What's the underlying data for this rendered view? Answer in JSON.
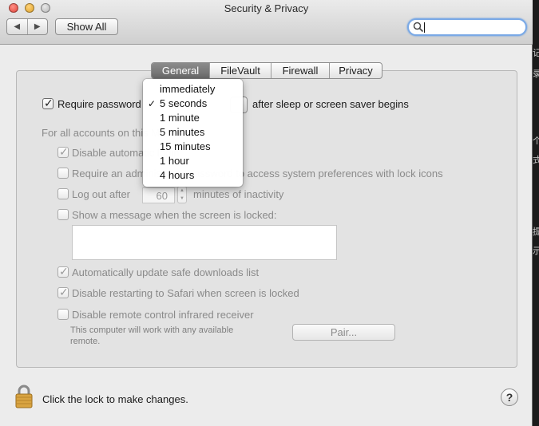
{
  "window": {
    "title": "Security & Privacy"
  },
  "toolbar": {
    "back_glyph": "◀",
    "forward_glyph": "▶",
    "show_all_label": "Show All",
    "search_placeholder": ""
  },
  "tabs": [
    {
      "label": "General",
      "active": true
    },
    {
      "label": "FileVault",
      "active": false
    },
    {
      "label": "Firewall",
      "active": false
    },
    {
      "label": "Privacy",
      "active": false
    }
  ],
  "general": {
    "require_password": {
      "checked": true,
      "label": "Require password",
      "selected_delay": "5 seconds",
      "suffix": "after sleep or screen saver begins"
    },
    "for_all_accounts_label": "For all accounts on this Mac:",
    "disable_auto_login": {
      "checked": true,
      "label": "Disable automatic login"
    },
    "require_admin_password": {
      "checked": false,
      "label": "Require an administrator password to access system preferences with lock icons"
    },
    "log_out_after": {
      "checked": false,
      "label": "Log out after",
      "minutes": "60",
      "suffix": "minutes of inactivity"
    },
    "show_message": {
      "checked": false,
      "label": "Show a message when the screen is locked:",
      "message": ""
    },
    "auto_update_safe_downloads": {
      "checked": true,
      "label": "Automatically update safe downloads list"
    },
    "disable_safari_restart": {
      "checked": true,
      "label": "Disable restarting to Safari when screen is locked"
    },
    "disable_remote_ir": {
      "checked": false,
      "label": "Disable remote control infrared receiver",
      "note_line1": "This computer will work with any available",
      "note_line2": "remote.",
      "pair_label": "Pair..."
    }
  },
  "delay_menu": {
    "options": [
      "immediately",
      "5 seconds",
      "1 minute",
      "5 minutes",
      "15 minutes",
      "1 hour",
      "4 hours"
    ],
    "selected": "5 seconds",
    "check_glyph": "✓"
  },
  "footer": {
    "lock_text": "Click the lock to make changes.",
    "help_label": "?"
  },
  "side_glyphs": [
    "记",
    "录",
    "个",
    "式",
    "提",
    "示"
  ],
  "colors": {
    "active_tab": "#7a7a7a",
    "search_focus": "#7aa9e6",
    "lock_gold": "#d9a441"
  }
}
